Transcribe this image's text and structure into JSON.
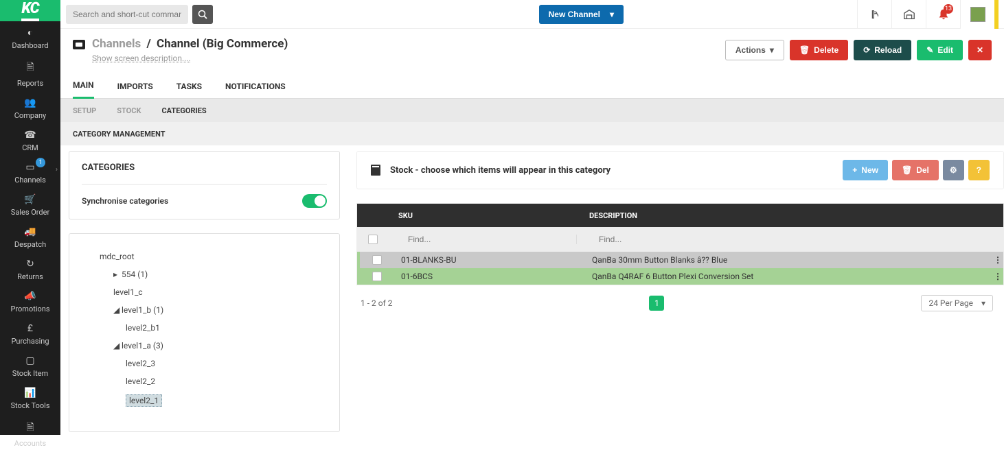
{
  "logo": "KC",
  "sidebar": {
    "items": [
      {
        "label": "Dashboard",
        "icon": "◐"
      },
      {
        "label": "Reports",
        "icon": "🗎"
      },
      {
        "label": "Company",
        "icon": "👥"
      },
      {
        "label": "CRM",
        "icon": "☎"
      },
      {
        "label": "Channels",
        "icon": "▭",
        "badge": "1",
        "chev": true
      },
      {
        "label": "Sales Order",
        "icon": "🛒"
      },
      {
        "label": "Despatch",
        "icon": "🚚"
      },
      {
        "label": "Returns",
        "icon": "↻"
      },
      {
        "label": "Promotions",
        "icon": "📣"
      },
      {
        "label": "Purchasing",
        "icon": "£"
      },
      {
        "label": "Stock Item",
        "icon": "▢"
      },
      {
        "label": "Stock Tools",
        "icon": "📊"
      },
      {
        "label": "Accounts",
        "icon": "🗎"
      }
    ]
  },
  "topbar": {
    "search_placeholder": "Search and short-cut commands",
    "new_channel_label": "New Channel",
    "notif_count": "13"
  },
  "breadcrumb": {
    "root": "Channels",
    "current": "Channel (Big Commerce)",
    "screen_desc": "Show screen description...."
  },
  "header_actions": {
    "actions": "Actions",
    "delete": "Delete",
    "reload": "Reload",
    "edit": "Edit"
  },
  "tabs": [
    "MAIN",
    "IMPORTS",
    "TASKS",
    "NOTIFICATIONS"
  ],
  "subtabs": [
    "SETUP",
    "STOCK",
    "CATEGORIES"
  ],
  "subtab2": "CATEGORY MANAGEMENT",
  "categories": {
    "title": "CATEGORIES",
    "sync_label": "Synchronise categories",
    "tree": {
      "root": "mdc_root",
      "n1": "554 (1)",
      "n2": "level1_c",
      "n3": "level1_b (1)",
      "n3a": "level2_b1",
      "n4": "level1_a (3)",
      "n4a": "level2_3",
      "n4b": "level2_2",
      "n4c": "level2_1"
    }
  },
  "stock": {
    "title": "Stock - choose which items will appear in this category",
    "new_label": "New",
    "del_label": "Del",
    "help_label": "?",
    "columns": {
      "sku": "SKU",
      "desc": "DESCRIPTION"
    },
    "find_placeholder": "Find...",
    "rows": [
      {
        "sku": "01-BLANKS-BU",
        "desc": "QanBa 30mm Button Blanks â?? Blue"
      },
      {
        "sku": "01-6BCS",
        "desc": "QanBa Q4RAF 6 Button Plexi Conversion Set"
      }
    ],
    "pag_info": "1 - 2 of 2",
    "page": "1",
    "per_page": "24 Per Page"
  }
}
